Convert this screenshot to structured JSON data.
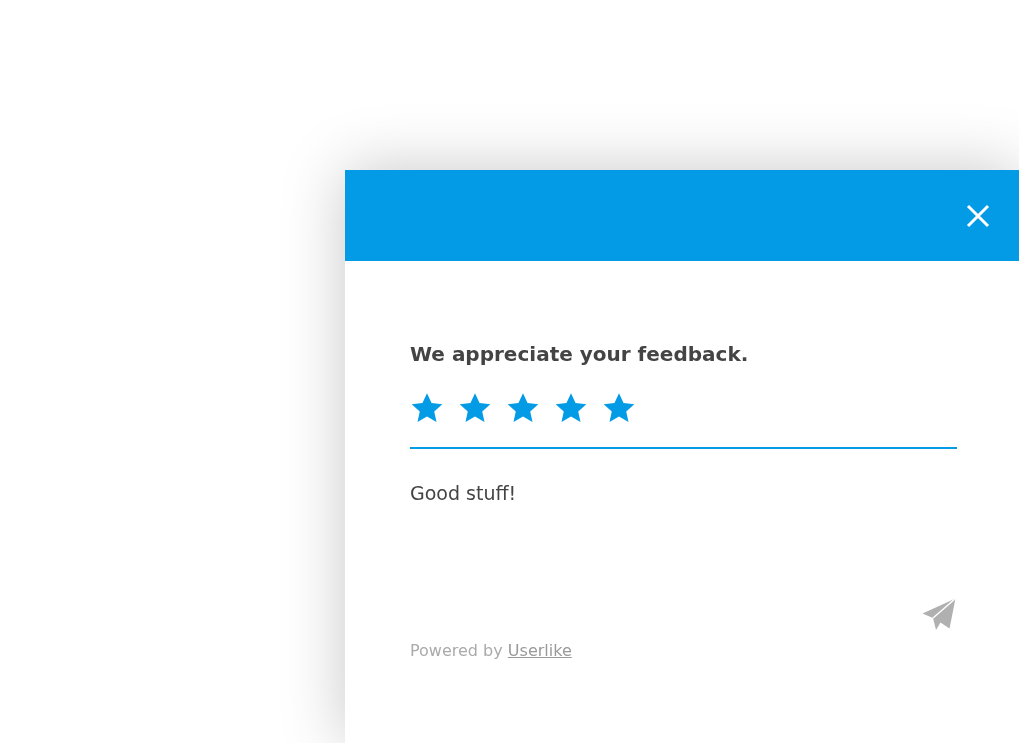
{
  "heading": "We appreciate your feedback.",
  "rating": {
    "stars": 5
  },
  "comment": {
    "value": "Good stuff!"
  },
  "footer": {
    "text": "Powered by",
    "link": "Userlike"
  }
}
